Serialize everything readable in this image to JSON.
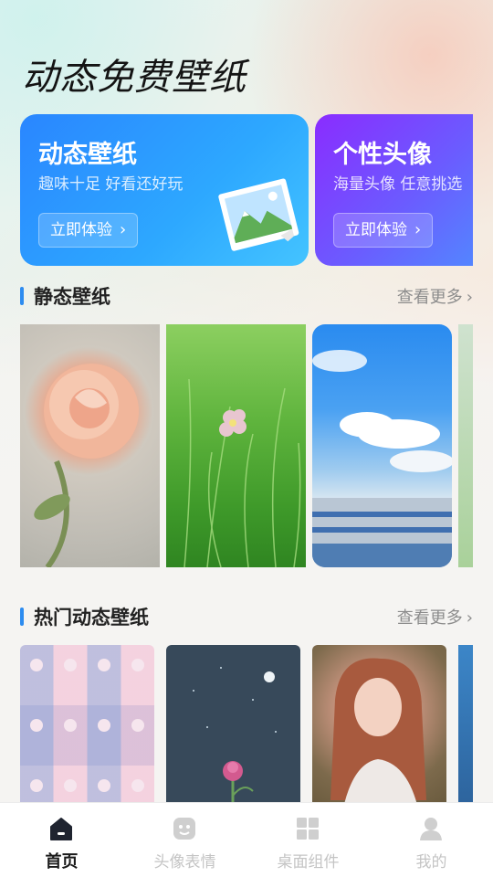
{
  "page": {
    "title": "动态免费壁纸"
  },
  "feature_cards": [
    {
      "title": "动态壁纸",
      "subtitle": "趣味十足 好看还好玩",
      "button": "立即体验",
      "icon": "landscape-photo-icon"
    },
    {
      "title": "个性头像",
      "subtitle": "海量头像 任意挑选",
      "button": "立即体验",
      "icon": ""
    }
  ],
  "sections": {
    "static": {
      "title": "静态壁纸",
      "more": "查看更多"
    },
    "hot_dynamic": {
      "title": "热门动态壁纸",
      "more": "查看更多"
    }
  },
  "static_thumbs": [
    "rose-wallpaper",
    "grass-flower-wallpaper",
    "sky-building-wallpaper"
  ],
  "hot_thumbs": [
    "girl-grid-wallpaper",
    "night-flower-wallpaper",
    "portrait-wallpaper"
  ],
  "tab_bar": {
    "active": "首页",
    "items": [
      {
        "label": "首页",
        "icon": "home-icon"
      },
      {
        "label": "头像表情",
        "icon": "emoji-face-icon"
      },
      {
        "label": "桌面组件",
        "icon": "widget-grid-icon"
      },
      {
        "label": "我的",
        "icon": "person-icon"
      }
    ]
  },
  "colors": {
    "accent": "#2d8cf0",
    "card_blue": "#2a86ff",
    "card_purple": "#8a2cff"
  }
}
